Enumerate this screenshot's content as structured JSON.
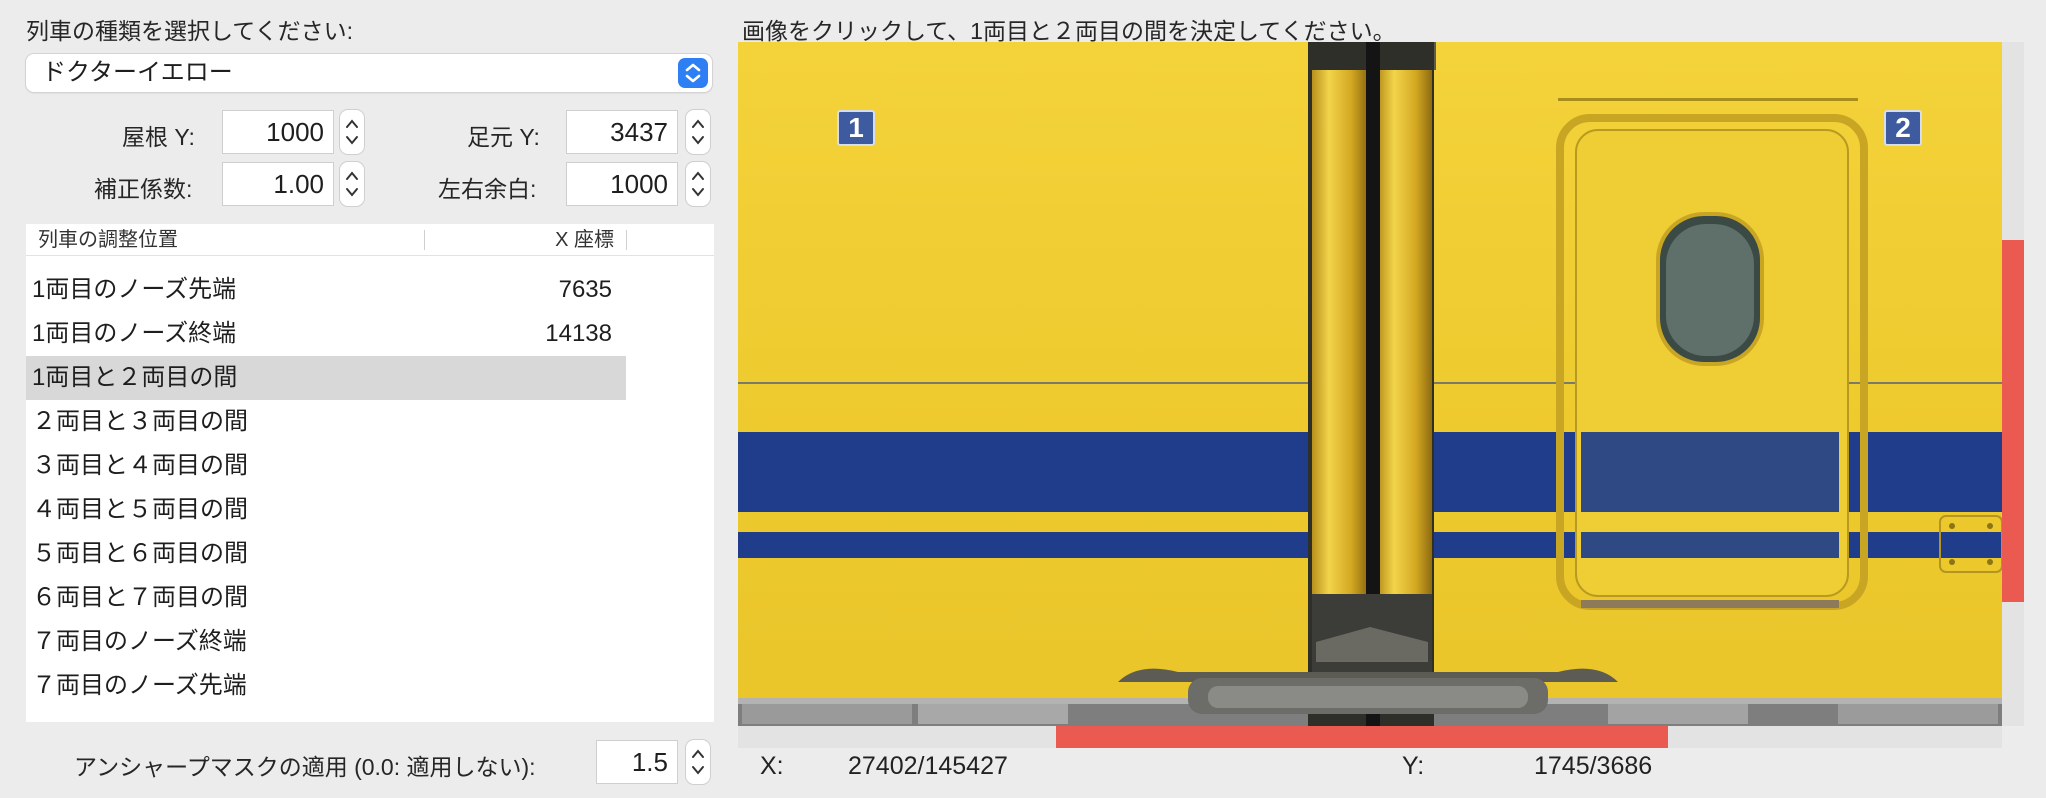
{
  "left_panel": {
    "select_label": "列車の種類を選択してください:",
    "selected_train": "ドクターイエロー",
    "fields": {
      "roof_y_label": "屋根 Y:",
      "roof_y_value": "1000",
      "foot_y_label": "足元 Y:",
      "foot_y_value": "3437",
      "coef_label": "補正係数:",
      "coef_value": "1.00",
      "margin_label": "左右余白:",
      "margin_value": "1000"
    },
    "table": {
      "col_position": "列車の調整位置",
      "col_x": "X 座標",
      "rows": [
        {
          "name": "1両目のノーズ先端",
          "x": "7635"
        },
        {
          "name": "1両目のノーズ終端",
          "x": "14138"
        },
        {
          "name": "1両目と２両目の間",
          "x": ""
        },
        {
          "name": "２両目と３両目の間",
          "x": ""
        },
        {
          "name": "３両目と４両目の間",
          "x": ""
        },
        {
          "name": "４両目と５両目の間",
          "x": ""
        },
        {
          "name": "５両目と６両目の間",
          "x": ""
        },
        {
          "name": "６両目と７両目の間",
          "x": ""
        },
        {
          "name": "７両目のノーズ終端",
          "x": ""
        },
        {
          "name": "７両目のノーズ先端",
          "x": ""
        }
      ],
      "selected_index": 2
    },
    "unsharp_label": "アンシャープマスクの適用 (0.0: 適用しない):",
    "unsharp_value": "1.5"
  },
  "right_panel": {
    "instruction": "画像をクリックして、1両目と２両目の間を決定してください。",
    "car_labels": [
      "1",
      "2"
    ],
    "x_label": "X:",
    "x_value": "27402/145427",
    "y_label": "Y:",
    "y_value": "1745/3686"
  },
  "colors": {
    "train_yellow": "#f0cc33",
    "stripe_blue": "#1f3d8a",
    "scrollbar_accent": "#ea5a50",
    "select_accent": "#2f7ff4"
  }
}
